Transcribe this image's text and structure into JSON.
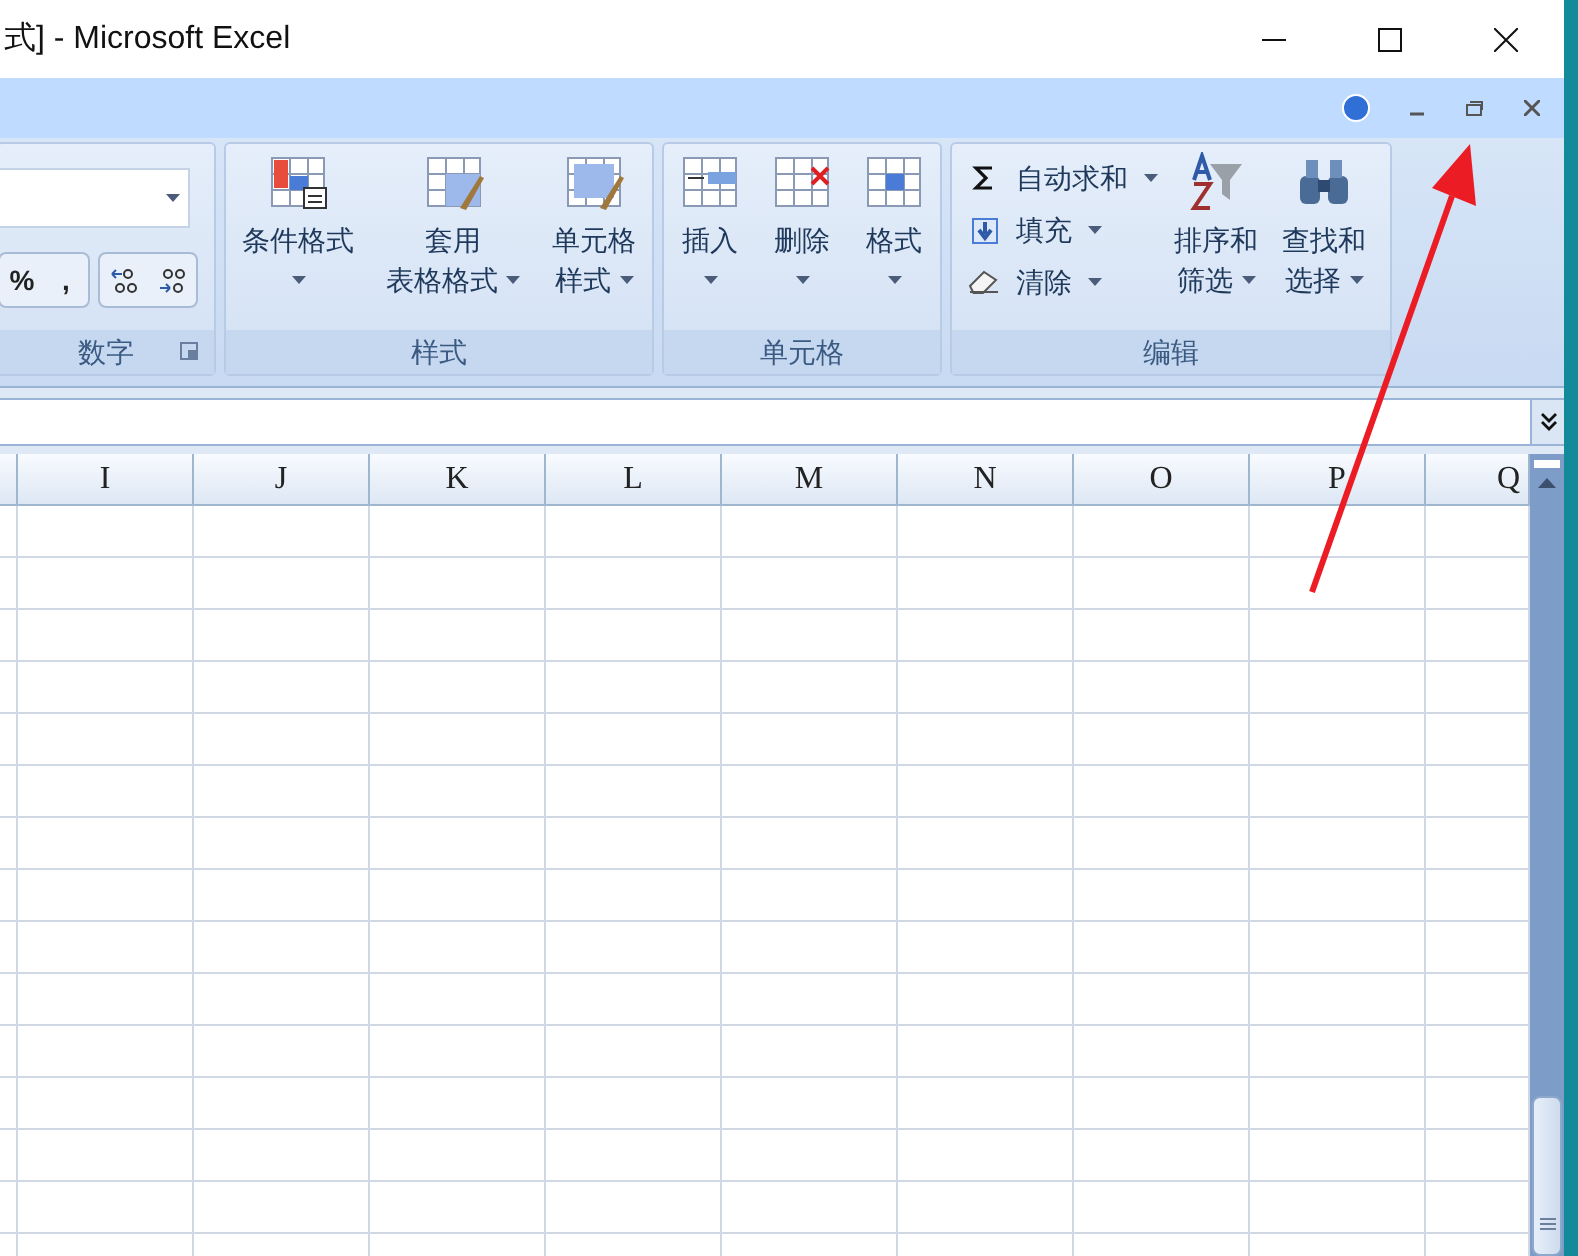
{
  "window": {
    "title": "式] - Microsoft Excel"
  },
  "ribbon": {
    "groups": [
      {
        "kind": "number",
        "label": "数字",
        "buttons": [
          "%",
          ","
        ]
      },
      {
        "kind": "large",
        "label": "样式",
        "buttons": [
          {
            "lines": [
              "条件格式"
            ]
          },
          {
            "lines": [
              "套用",
              "表格格式"
            ]
          },
          {
            "lines": [
              "单元格",
              "样式"
            ]
          }
        ]
      },
      {
        "kind": "large",
        "label": "单元格",
        "buttons": [
          {
            "lines": [
              "插入"
            ]
          },
          {
            "lines": [
              "删除"
            ]
          },
          {
            "lines": [
              "格式"
            ]
          }
        ]
      },
      {
        "kind": "editing",
        "label": "编辑",
        "small": [
          {
            "text": "自动求和"
          },
          {
            "text": "填充"
          },
          {
            "text": "清除"
          }
        ],
        "buttons": [
          {
            "lines": [
              "排序和",
              "筛选"
            ]
          },
          {
            "lines": [
              "查找和",
              "选择"
            ]
          }
        ]
      }
    ]
  },
  "sheet": {
    "columns": [
      "I",
      "J",
      "K",
      "L",
      "M",
      "N",
      "O",
      "P",
      "Q"
    ]
  }
}
